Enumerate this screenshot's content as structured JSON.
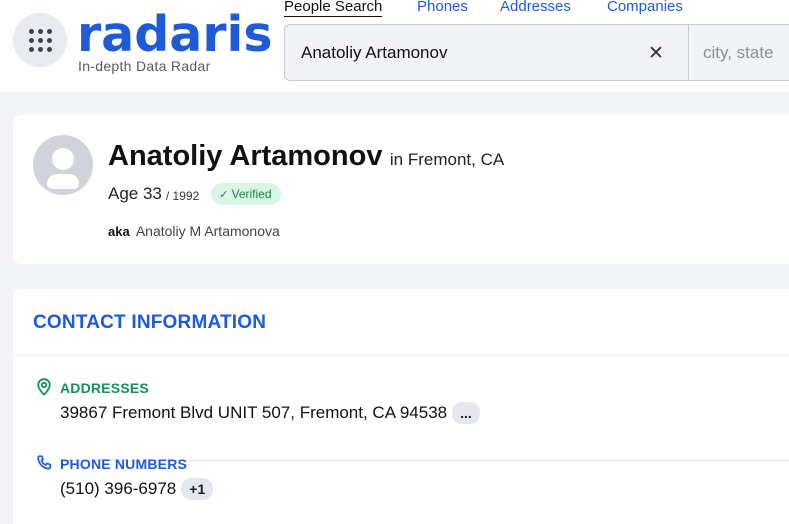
{
  "header": {
    "logo_text": "radaris",
    "tagline": "In-depth Data Radar",
    "nav": [
      {
        "label": "People Search",
        "active": true
      },
      {
        "label": "Phones",
        "active": false
      },
      {
        "label": "Addresses",
        "active": false
      },
      {
        "label": "Companies",
        "active": false
      }
    ],
    "search": {
      "name_value": "Anatoliy Artamonov",
      "clear_icon": "close-icon",
      "location_placeholder": "city, state"
    }
  },
  "profile": {
    "name": "Anatoliy Artamonov",
    "location": "in Fremont, CA",
    "age": "Age 33",
    "birth_year": "/ 1992",
    "verified_label": "Verified",
    "aka_label": "aka",
    "aka_value": "Anatoliy M Artamonova"
  },
  "contact": {
    "title": "CONTACT INFORMATION",
    "addresses": {
      "label": "ADDRESSES",
      "icon": "map-pin-icon",
      "value": "39867 Fremont Blvd UNIT 507, Fremont, CA 94538",
      "more": "..."
    },
    "phones": {
      "label": "PHONE NUMBERS",
      "icon": "phone-icon",
      "value": "(510) 396-6978",
      "more": "+1"
    }
  },
  "colors": {
    "brand_blue": "#1f5bd8",
    "address_green": "#16915a",
    "verified_bg": "#d9f5e6",
    "verified_text": "#178a4a"
  }
}
